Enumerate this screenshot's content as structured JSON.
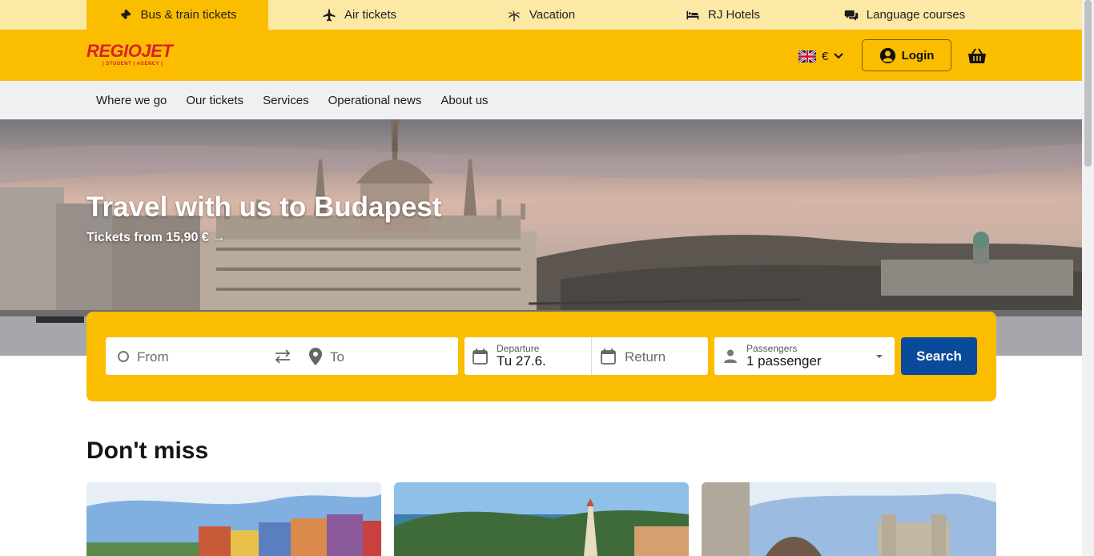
{
  "product_tabs": [
    {
      "label": "Bus & train tickets",
      "icon": "ticket-icon",
      "active": true
    },
    {
      "label": "Air tickets",
      "icon": "plane-icon",
      "active": false
    },
    {
      "label": "Vacation",
      "icon": "palm-tree-icon",
      "active": false
    },
    {
      "label": "RJ Hotels",
      "icon": "bed-icon",
      "active": false
    },
    {
      "label": "Language courses",
      "icon": "chat-bubbles-icon",
      "active": false
    }
  ],
  "header": {
    "logo_text": "REGIOJET",
    "logo_sub": "| STUDENT | AGENCY |",
    "currency": "€",
    "login_label": "Login",
    "brand_color": "#fbbd00"
  },
  "nav": {
    "items": [
      "Where we go",
      "Our tickets",
      "Services",
      "Operational news",
      "About us"
    ]
  },
  "hero": {
    "title": "Travel with us to Budapest",
    "subtitle": "Tickets from 15,90 € →"
  },
  "search": {
    "from_placeholder": "From",
    "to_placeholder": "To",
    "departure_label": "Departure",
    "departure_value": "Tu 27.6.",
    "return_placeholder": "Return",
    "passengers_label": "Passengers",
    "passengers_value": "1 passenger",
    "search_label": "Search",
    "button_color": "#0a4a9b"
  },
  "dont_miss": {
    "title": "Don't miss"
  }
}
